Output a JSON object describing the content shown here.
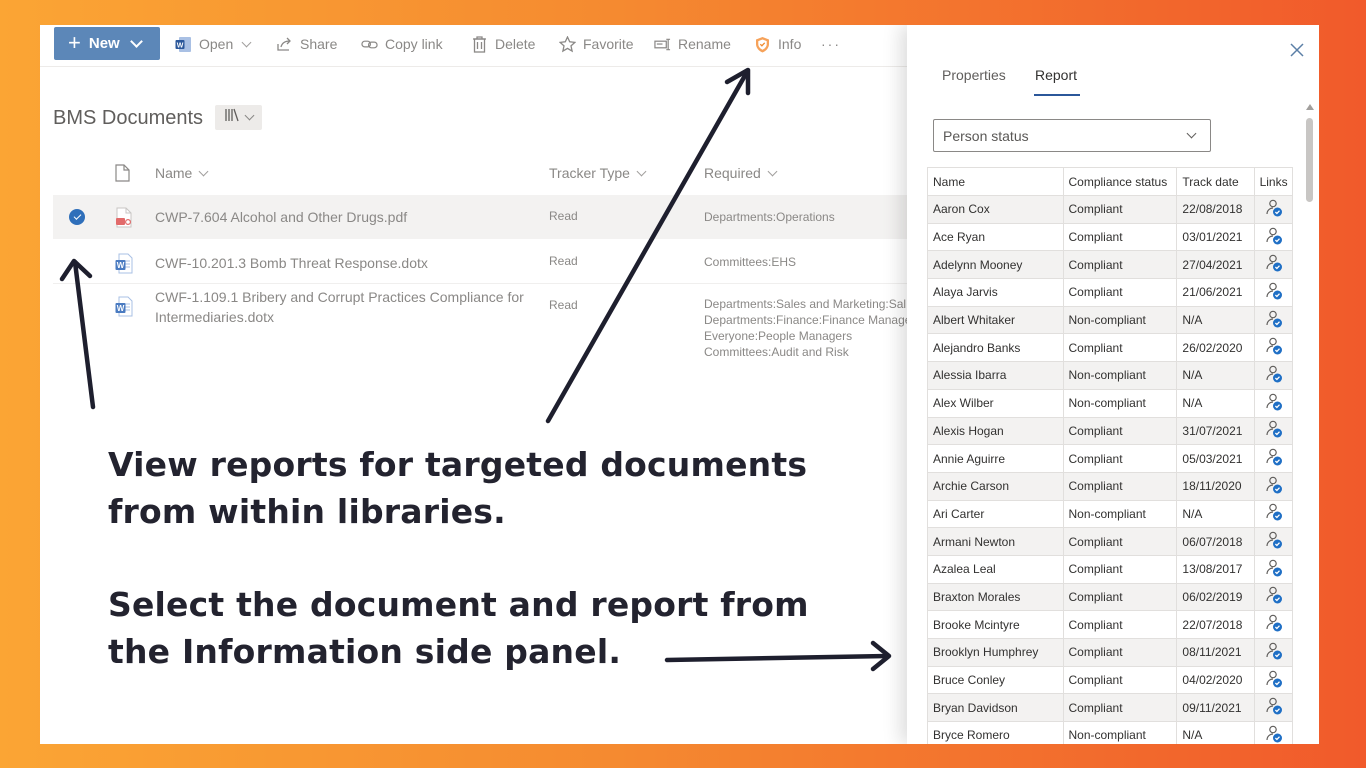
{
  "toolbar": {
    "new_label": "New",
    "open_label": "Open",
    "share_label": "Share",
    "copy_link_label": "Copy link",
    "delete_label": "Delete",
    "favorite_label": "Favorite",
    "rename_label": "Rename",
    "info_label": "Info",
    "more_label": "···"
  },
  "library": {
    "title": "BMS Documents",
    "columns": {
      "name": "Name",
      "tracker_type": "Tracker Type",
      "required": "Required"
    },
    "documents": [
      {
        "name": "CWP-7.604 Alcohol and Other Drugs.pdf",
        "tracker_type": "Read",
        "required": [
          "Departments:Operations"
        ],
        "file_type": "pdf",
        "selected": true
      },
      {
        "name": "CWF-10.201.3 Bomb Threat Response.dotx",
        "tracker_type": "Read",
        "required": [
          "Committees:EHS"
        ],
        "file_type": "word",
        "selected": false
      },
      {
        "name": "CWF-1.109.1 Bribery and Corrupt Practices Compliance for Intermediaries.dotx",
        "tracker_type": "Read",
        "required": [
          "Departments:Sales and Marketing:Sal",
          "Departments:Finance:Finance Manage",
          "Everyone:People Managers",
          "Committees:Audit and Risk"
        ],
        "file_type": "word",
        "selected": false
      }
    ]
  },
  "panel": {
    "tabs": [
      "Properties",
      "Report"
    ],
    "active_tab": "Report",
    "dropdown_value": "Person status",
    "table_headers": [
      "Name",
      "Compliance status",
      "Track date",
      "Links"
    ],
    "rows": [
      {
        "name": "Aaron Cox",
        "status": "Compliant",
        "date": "22/08/2018"
      },
      {
        "name": "Ace Ryan",
        "status": "Compliant",
        "date": "03/01/2021"
      },
      {
        "name": "Adelynn Mooney",
        "status": "Compliant",
        "date": "27/04/2021"
      },
      {
        "name": "Alaya Jarvis",
        "status": "Compliant",
        "date": "21/06/2021"
      },
      {
        "name": "Albert Whitaker",
        "status": "Non-compliant",
        "date": "N/A"
      },
      {
        "name": "Alejandro Banks",
        "status": "Compliant",
        "date": "26/02/2020"
      },
      {
        "name": "Alessia Ibarra",
        "status": "Non-compliant",
        "date": "N/A"
      },
      {
        "name": "Alex Wilber",
        "status": "Non-compliant",
        "date": "N/A"
      },
      {
        "name": "Alexis Hogan",
        "status": "Compliant",
        "date": "31/07/2021"
      },
      {
        "name": "Annie Aguirre",
        "status": "Compliant",
        "date": "05/03/2021"
      },
      {
        "name": "Archie Carson",
        "status": "Compliant",
        "date": "18/11/2020"
      },
      {
        "name": "Ari Carter",
        "status": "Non-compliant",
        "date": "N/A"
      },
      {
        "name": "Armani Newton",
        "status": "Compliant",
        "date": "06/07/2018"
      },
      {
        "name": "Azalea Leal",
        "status": "Compliant",
        "date": "13/08/2017"
      },
      {
        "name": "Braxton Morales",
        "status": "Compliant",
        "date": "06/02/2019"
      },
      {
        "name": "Brooke Mcintyre",
        "status": "Compliant",
        "date": "22/07/2018"
      },
      {
        "name": "Brooklyn Humphrey",
        "status": "Compliant",
        "date": "08/11/2021"
      },
      {
        "name": "Bruce Conley",
        "status": "Compliant",
        "date": "04/02/2020"
      },
      {
        "name": "Bryan Davidson",
        "status": "Compliant",
        "date": "09/11/2021"
      },
      {
        "name": "Bryce Romero",
        "status": "Non-compliant",
        "date": "N/A"
      }
    ]
  },
  "captions": {
    "line1": "View reports for targeted documents",
    "line2": "from within libraries.",
    "line3": "Select the document and report from",
    "line4": "the Information side panel."
  },
  "colors": {
    "background_start": "#fba534",
    "background_end": "#f15a2b",
    "new_button": "#5c87b8",
    "accent": "#2b579a",
    "caption_text": "#23232f"
  }
}
